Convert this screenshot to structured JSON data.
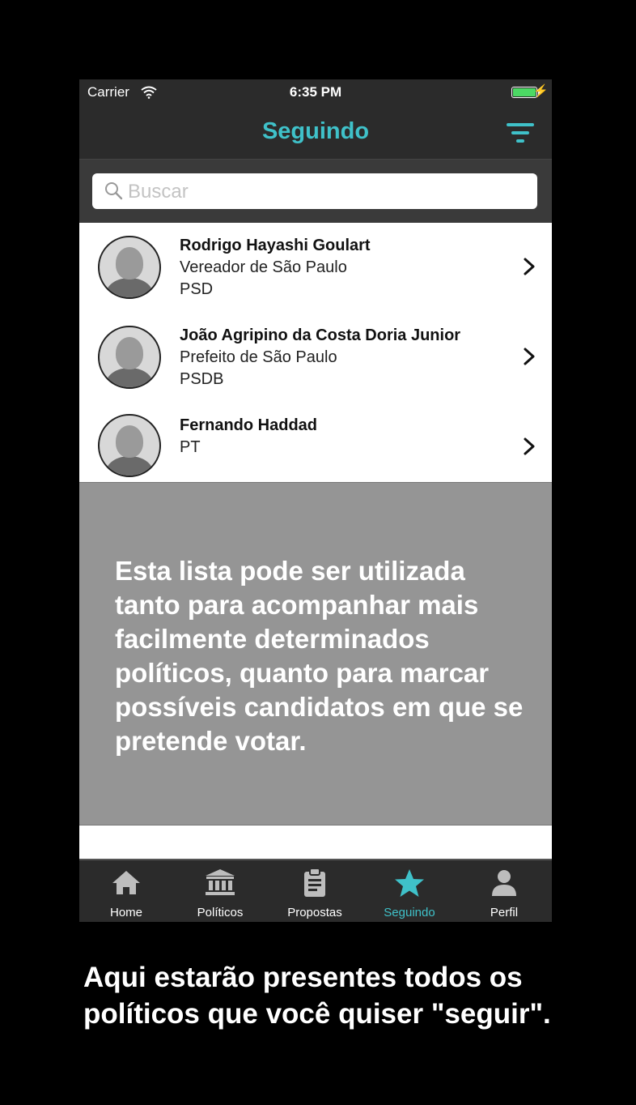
{
  "status_bar": {
    "carrier": "Carrier",
    "time": "6:35 PM",
    "wifi_icon": "wifi-icon",
    "battery_icon": "battery-icon"
  },
  "header": {
    "title": "Seguindo",
    "filter_icon": "filter-icon",
    "accent_color": "#3fc1c9"
  },
  "search": {
    "placeholder": "Buscar",
    "icon": "search-icon"
  },
  "list": [
    {
      "name": "Rodrigo Hayashi Goulart",
      "lines": [
        "Vereador de São Paulo",
        "PSD"
      ]
    },
    {
      "name": "João Agripino da Costa Doria Junior",
      "lines": [
        "Prefeito de São Paulo",
        "PSDB"
      ]
    },
    {
      "name": "Fernando Haddad",
      "lines": [
        "PT"
      ]
    }
  ],
  "overlay": {
    "message": "Esta lista pode ser utilizada tanto para acompanhar mais facilmente determinados políticos, quanto para marcar possíveis candidatos em que se pretende votar."
  },
  "tabs": [
    {
      "label": "Home",
      "icon": "home-icon",
      "active": false
    },
    {
      "label": "Políticos",
      "icon": "building-icon",
      "active": false
    },
    {
      "label": "Propostas",
      "icon": "clipboard-icon",
      "active": false
    },
    {
      "label": "Seguindo",
      "icon": "star-icon",
      "active": true
    },
    {
      "label": "Perfil",
      "icon": "user-icon",
      "active": false
    }
  ],
  "caption": "Aqui estarão presentes todos os políticos que você quiser \"seguir\"."
}
